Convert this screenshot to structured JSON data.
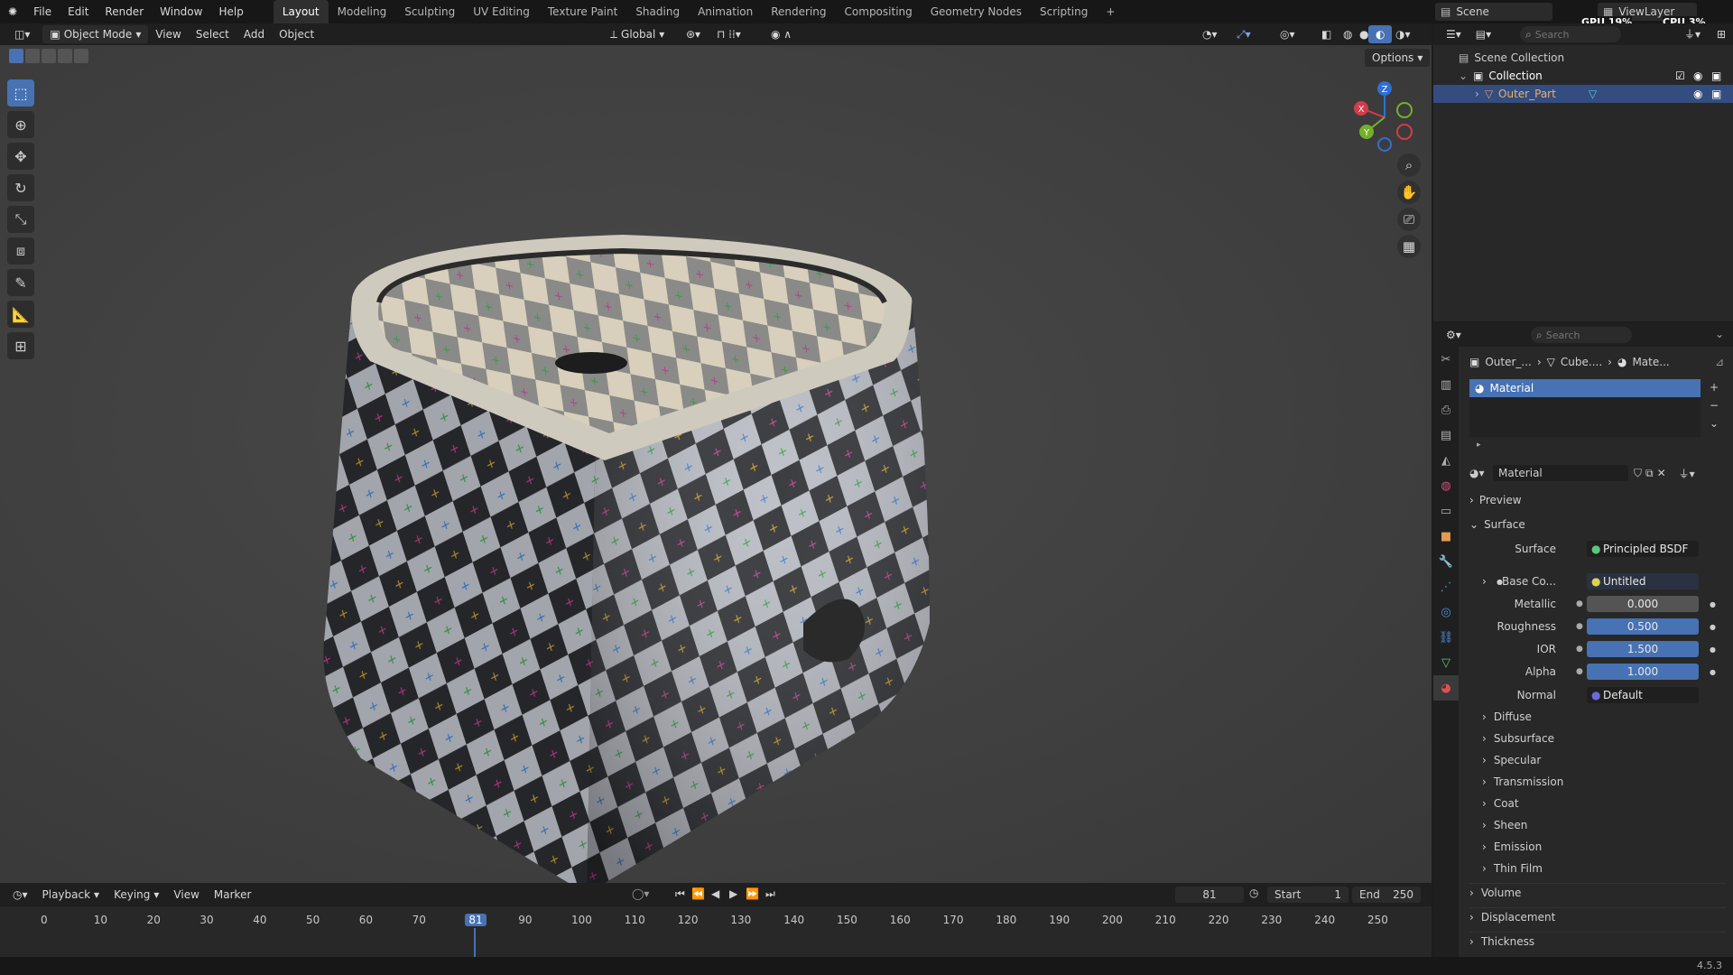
{
  "topbar": {
    "menus": [
      "File",
      "Edit",
      "Render",
      "Window",
      "Help"
    ],
    "workspaces": [
      "Layout",
      "Modeling",
      "Sculpting",
      "UV Editing",
      "Texture Paint",
      "Shading",
      "Animation",
      "Rendering",
      "Compositing",
      "Geometry Nodes",
      "Scripting"
    ],
    "add": "+",
    "scene": "Scene",
    "viewlayer": "ViewLayer",
    "gpu": "GPU 19%",
    "cpu": "CPU 3%"
  },
  "vphead": {
    "mode": "Object Mode",
    "view": "View",
    "select": "Select",
    "add": "Add",
    "object": "Object",
    "orientation": "Global",
    "options": "Options"
  },
  "gizmo": {
    "x": "X",
    "y": "Y",
    "z": "Z"
  },
  "outliner": {
    "search_placeholder": "Search",
    "scene_collection": "Scene Collection",
    "collection": "Collection",
    "object": "Outer_Part"
  },
  "props": {
    "search_placeholder": "Search",
    "crumb_obj": "Outer_...",
    "crumb_mesh": "Cube....",
    "crumb_mat": "Mate...",
    "slot": "Material",
    "material_name": "Material",
    "preview": "Preview",
    "surface_panel": "Surface",
    "surface_label": "Surface",
    "surface_value": "Principled BSDF",
    "basecolor_label": "Base Co...",
    "basecolor_value": "Untitled",
    "fields": [
      {
        "label": "Metallic",
        "value": "0.000",
        "blue": false
      },
      {
        "label": "Roughness",
        "value": "0.500",
        "blue": true
      },
      {
        "label": "IOR",
        "value": "1.500",
        "blue": true
      },
      {
        "label": "Alpha",
        "value": "1.000",
        "blue": true
      }
    ],
    "normal_label": "Normal",
    "normal_value": "Default",
    "subpanels": [
      "Diffuse",
      "Subsurface",
      "Specular",
      "Transmission",
      "Coat",
      "Sheen",
      "Emission",
      "Thin Film"
    ],
    "panels": [
      "Volume",
      "Displacement",
      "Thickness"
    ]
  },
  "timeline": {
    "playback": "Playback",
    "keying": "Keying",
    "view": "View",
    "marker": "Marker",
    "current": "81",
    "start_label": "Start",
    "start": "1",
    "end_label": "End",
    "end": "250",
    "ticks": [
      "0",
      "10",
      "20",
      "30",
      "40",
      "50",
      "60",
      "70",
      "81",
      "90",
      "100",
      "110",
      "120",
      "130",
      "140",
      "150",
      "160",
      "170",
      "180",
      "190",
      "200",
      "210",
      "220",
      "230",
      "240",
      "250"
    ]
  },
  "status": {
    "version": "4.5.3"
  }
}
